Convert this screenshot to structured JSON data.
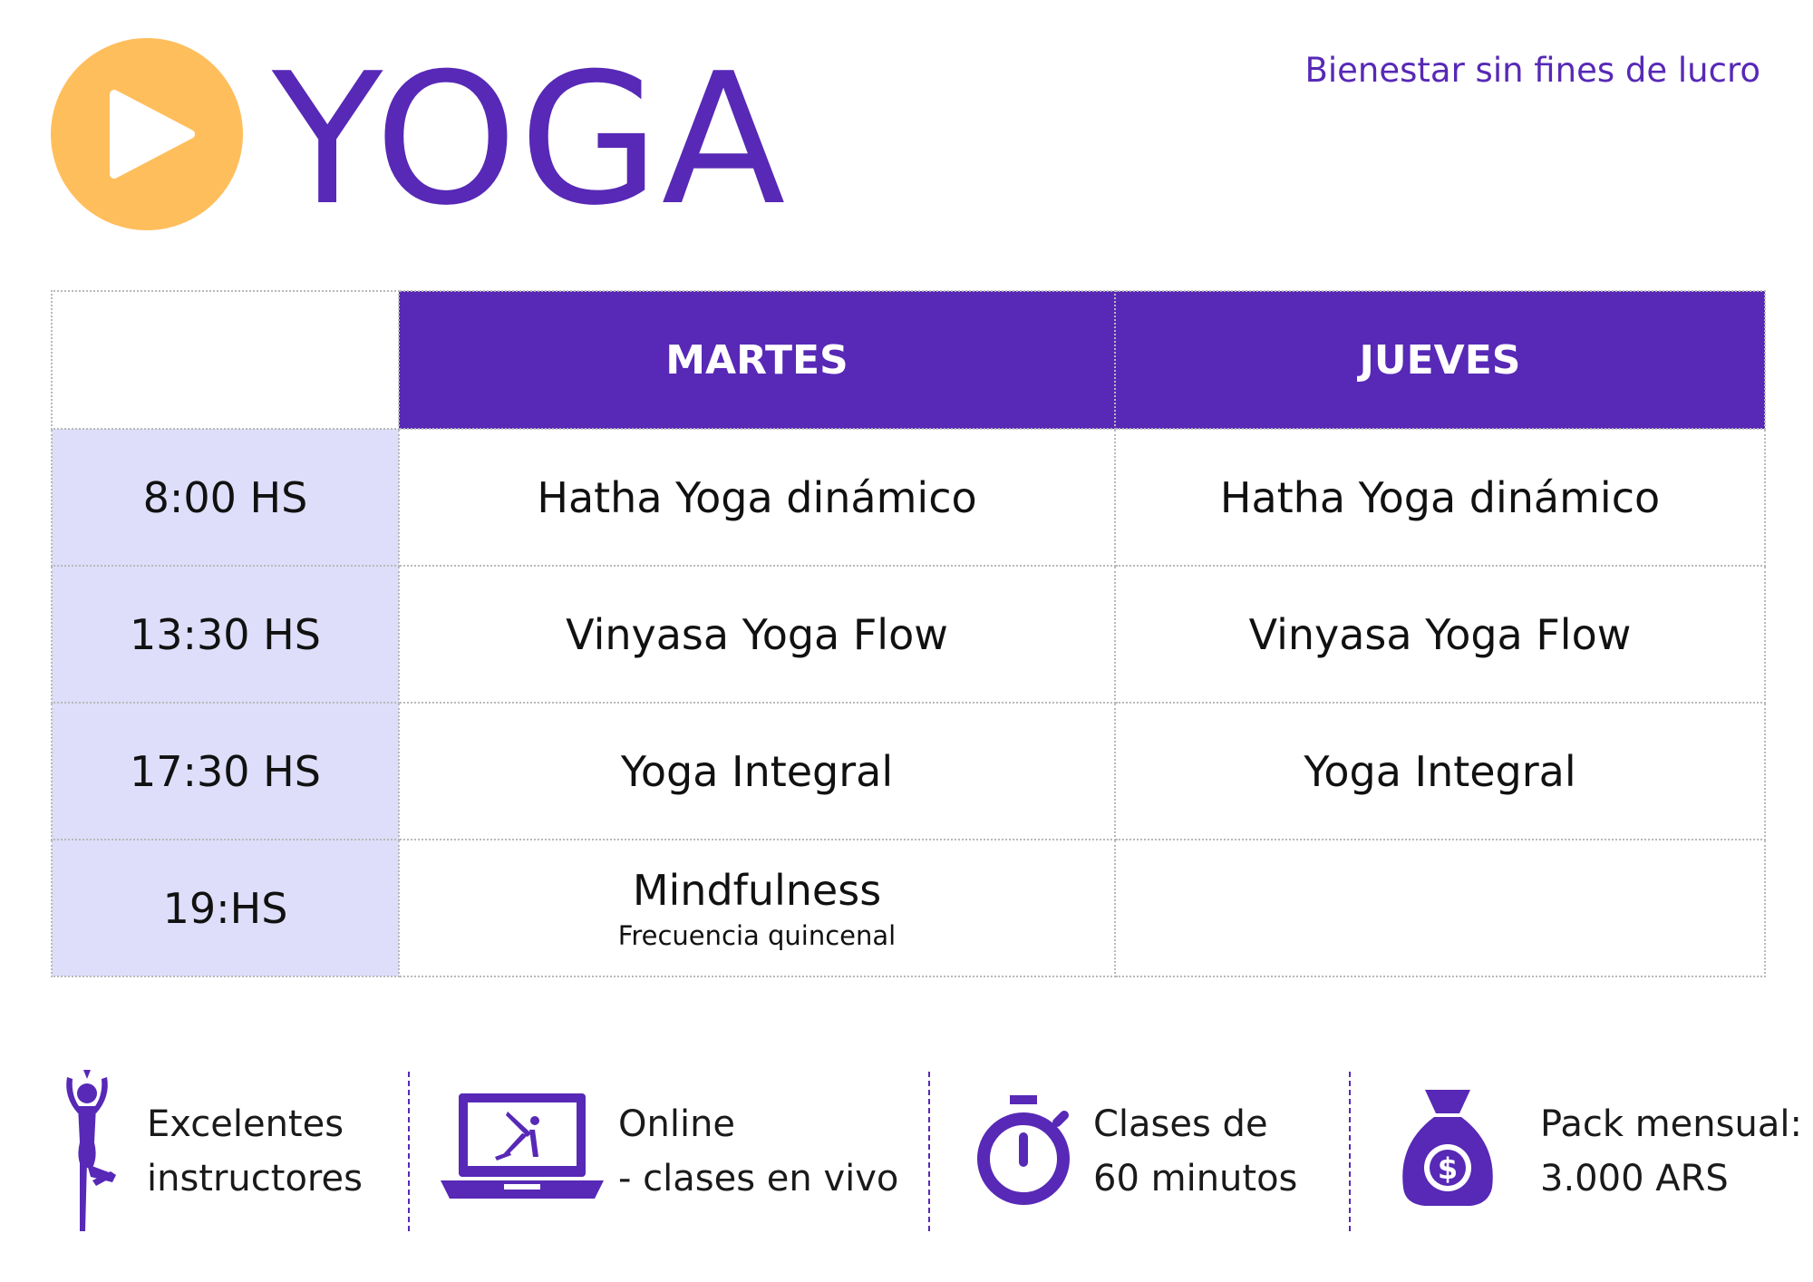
{
  "header": {
    "title": "YOGA",
    "tagline": "Bienestar sin fines de lucro",
    "logo_icon": "play-icon"
  },
  "schedule": {
    "days": [
      "MARTES",
      "JUEVES"
    ],
    "rows": [
      {
        "time": "8:00 HS",
        "martes": "Hatha Yoga dinámico",
        "jueves": "Hatha Yoga dinámico"
      },
      {
        "time": "13:30 HS",
        "martes": "Vinyasa Yoga Flow",
        "jueves": "Vinyasa Yoga Flow"
      },
      {
        "time": "17:30 HS",
        "martes": "Yoga Integral",
        "jueves": "Yoga Integral"
      },
      {
        "time": "19:HS",
        "martes": "Mindfulness",
        "martes_note": "Frecuencia quincenal",
        "jueves": ""
      }
    ]
  },
  "features": [
    {
      "icon": "yoga-pose-icon",
      "line1": "Excelentes",
      "line2": "instructores"
    },
    {
      "icon": "laptop-yoga-icon",
      "line1": "Online",
      "line2": "- clases en vivo"
    },
    {
      "icon": "stopwatch-icon",
      "line1": "Clases de",
      "line2": "60 minutos"
    },
    {
      "icon": "money-bag-icon",
      "line1": "Pack mensual:",
      "line2": "3.000 ARS"
    }
  ],
  "colors": {
    "primary": "#5729b6",
    "logo": "#ffbe5c",
    "time_cell": "#dedefa"
  }
}
